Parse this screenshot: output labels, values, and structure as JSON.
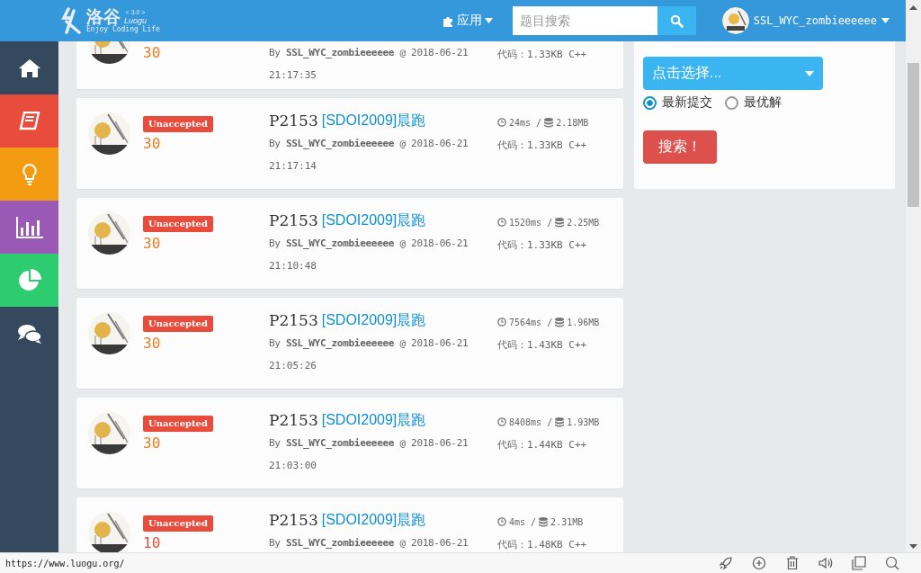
{
  "header": {
    "logo_title": "洛谷",
    "logo_version": "< 3.0 >",
    "logo_subtitle": "Luogu",
    "logo_slogan": "Enjoy Coding Life",
    "apps_menu": "应用",
    "search": {
      "placeholder": "题目搜索"
    },
    "username": "SSL_WYC_zombieeeeee"
  },
  "sidebar": {
    "items": [
      {
        "kind": "home",
        "color": "#34495e"
      },
      {
        "kind": "book",
        "color": "#e74c3c"
      },
      {
        "kind": "bulb",
        "color": "#f39c12"
      },
      {
        "kind": "chart",
        "color": "#9b59b6"
      },
      {
        "kind": "pie",
        "color": "#2ecc71"
      },
      {
        "kind": "chat",
        "color": "#34495e"
      }
    ]
  },
  "records": [
    {
      "score": "30",
      "color": "#e67e22",
      "by_line": "By **SSL_WYC_zombieeeeee** @ 2018-06-21",
      "time": "21:17:35",
      "code": "代码：1.33KB C++"
    },
    {
      "status": "Unaccepted",
      "score": "30",
      "color": "#e67e22",
      "problem_id": "P2153",
      "problem_title": "[SDOI2009]晨跑",
      "by_line": "By **SSL_WYC_zombieeeeee** @ 2018-06-21",
      "time": "21:17:14",
      "run_time": "24ms /",
      "memory": "2.18MB",
      "code": "代码：1.33KB C++"
    },
    {
      "status": "Unaccepted",
      "score": "30",
      "color": "#e67e22",
      "problem_id": "P2153",
      "problem_title": "[SDOI2009]晨跑",
      "by_line": "By **SSL_WYC_zombieeeeee** @ 2018-06-21",
      "time": "21:10:48",
      "run_time": "1520ms /",
      "memory": "2.25MB",
      "code": "代码：1.33KB C++"
    },
    {
      "status": "Unaccepted",
      "score": "30",
      "color": "#e67e22",
      "problem_id": "P2153",
      "problem_title": "[SDOI2009]晨跑",
      "by_line": "By **SSL_WYC_zombieeeeee** @ 2018-06-21",
      "time": "21:05:26",
      "run_time": "7564ms /",
      "memory": "1.96MB",
      "code": "代码：1.43KB C++"
    },
    {
      "status": "Unaccepted",
      "score": "30",
      "color": "#e67e22",
      "problem_id": "P2153",
      "problem_title": "[SDOI2009]晨跑",
      "by_line": "By **SSL_WYC_zombieeeeee** @ 2018-06-21",
      "time": "21:03:00",
      "run_time": "8408ms /",
      "memory": "1.93MB",
      "code": "代码：1.44KB C++"
    },
    {
      "status": "Unaccepted",
      "score": "10",
      "color": "#e74c3c",
      "problem_id": "P2153",
      "problem_title": "[SDOI2009]晨跑",
      "by_line": "By **SSL_WYC_zombieeeeee** @ 2018-06-21",
      "run_time": "4ms /",
      "memory": "2.31MB",
      "code": "代码：1.48KB C++"
    }
  ],
  "filter": {
    "select": "点击选择...",
    "radios": [
      {
        "label": "最新提交",
        "selected": true
      },
      {
        "label": "最优解",
        "selected": false
      }
    ],
    "button": "搜索！"
  },
  "status_bar": {
    "url": "https://www.luogu.org/"
  }
}
